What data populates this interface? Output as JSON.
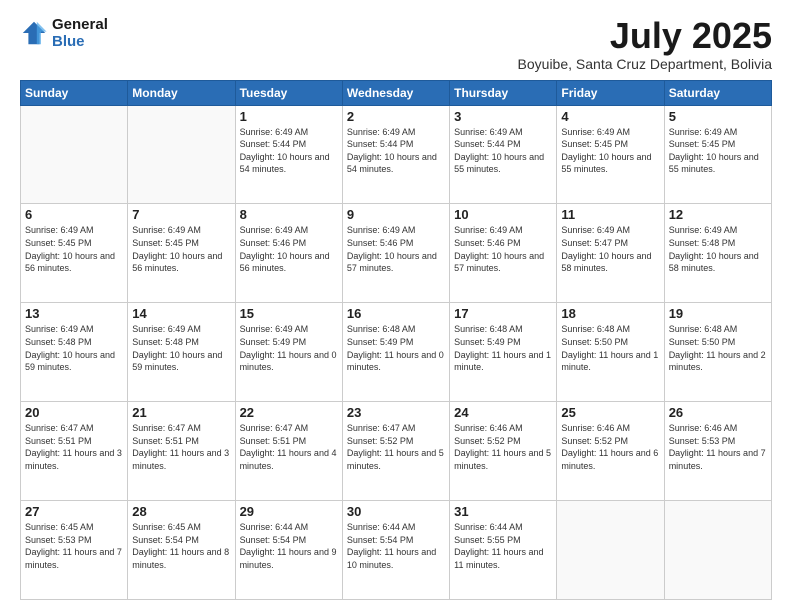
{
  "logo": {
    "line1": "General",
    "line2": "Blue"
  },
  "title": "July 2025",
  "subtitle": "Boyuibe, Santa Cruz Department, Bolivia",
  "days_of_week": [
    "Sunday",
    "Monday",
    "Tuesday",
    "Wednesday",
    "Thursday",
    "Friday",
    "Saturday"
  ],
  "weeks": [
    [
      {
        "day": "",
        "info": ""
      },
      {
        "day": "",
        "info": ""
      },
      {
        "day": "1",
        "info": "Sunrise: 6:49 AM\nSunset: 5:44 PM\nDaylight: 10 hours and 54 minutes."
      },
      {
        "day": "2",
        "info": "Sunrise: 6:49 AM\nSunset: 5:44 PM\nDaylight: 10 hours and 54 minutes."
      },
      {
        "day": "3",
        "info": "Sunrise: 6:49 AM\nSunset: 5:44 PM\nDaylight: 10 hours and 55 minutes."
      },
      {
        "day": "4",
        "info": "Sunrise: 6:49 AM\nSunset: 5:45 PM\nDaylight: 10 hours and 55 minutes."
      },
      {
        "day": "5",
        "info": "Sunrise: 6:49 AM\nSunset: 5:45 PM\nDaylight: 10 hours and 55 minutes."
      }
    ],
    [
      {
        "day": "6",
        "info": "Sunrise: 6:49 AM\nSunset: 5:45 PM\nDaylight: 10 hours and 56 minutes."
      },
      {
        "day": "7",
        "info": "Sunrise: 6:49 AM\nSunset: 5:45 PM\nDaylight: 10 hours and 56 minutes."
      },
      {
        "day": "8",
        "info": "Sunrise: 6:49 AM\nSunset: 5:46 PM\nDaylight: 10 hours and 56 minutes."
      },
      {
        "day": "9",
        "info": "Sunrise: 6:49 AM\nSunset: 5:46 PM\nDaylight: 10 hours and 57 minutes."
      },
      {
        "day": "10",
        "info": "Sunrise: 6:49 AM\nSunset: 5:46 PM\nDaylight: 10 hours and 57 minutes."
      },
      {
        "day": "11",
        "info": "Sunrise: 6:49 AM\nSunset: 5:47 PM\nDaylight: 10 hours and 58 minutes."
      },
      {
        "day": "12",
        "info": "Sunrise: 6:49 AM\nSunset: 5:48 PM\nDaylight: 10 hours and 58 minutes."
      }
    ],
    [
      {
        "day": "13",
        "info": "Sunrise: 6:49 AM\nSunset: 5:48 PM\nDaylight: 10 hours and 59 minutes."
      },
      {
        "day": "14",
        "info": "Sunrise: 6:49 AM\nSunset: 5:48 PM\nDaylight: 10 hours and 59 minutes."
      },
      {
        "day": "15",
        "info": "Sunrise: 6:49 AM\nSunset: 5:49 PM\nDaylight: 11 hours and 0 minutes."
      },
      {
        "day": "16",
        "info": "Sunrise: 6:48 AM\nSunset: 5:49 PM\nDaylight: 11 hours and 0 minutes."
      },
      {
        "day": "17",
        "info": "Sunrise: 6:48 AM\nSunset: 5:49 PM\nDaylight: 11 hours and 1 minute."
      },
      {
        "day": "18",
        "info": "Sunrise: 6:48 AM\nSunset: 5:50 PM\nDaylight: 11 hours and 1 minute."
      },
      {
        "day": "19",
        "info": "Sunrise: 6:48 AM\nSunset: 5:50 PM\nDaylight: 11 hours and 2 minutes."
      }
    ],
    [
      {
        "day": "20",
        "info": "Sunrise: 6:47 AM\nSunset: 5:51 PM\nDaylight: 11 hours and 3 minutes."
      },
      {
        "day": "21",
        "info": "Sunrise: 6:47 AM\nSunset: 5:51 PM\nDaylight: 11 hours and 3 minutes."
      },
      {
        "day": "22",
        "info": "Sunrise: 6:47 AM\nSunset: 5:51 PM\nDaylight: 11 hours and 4 minutes."
      },
      {
        "day": "23",
        "info": "Sunrise: 6:47 AM\nSunset: 5:52 PM\nDaylight: 11 hours and 5 minutes."
      },
      {
        "day": "24",
        "info": "Sunrise: 6:46 AM\nSunset: 5:52 PM\nDaylight: 11 hours and 5 minutes."
      },
      {
        "day": "25",
        "info": "Sunrise: 6:46 AM\nSunset: 5:52 PM\nDaylight: 11 hours and 6 minutes."
      },
      {
        "day": "26",
        "info": "Sunrise: 6:46 AM\nSunset: 5:53 PM\nDaylight: 11 hours and 7 minutes."
      }
    ],
    [
      {
        "day": "27",
        "info": "Sunrise: 6:45 AM\nSunset: 5:53 PM\nDaylight: 11 hours and 7 minutes."
      },
      {
        "day": "28",
        "info": "Sunrise: 6:45 AM\nSunset: 5:54 PM\nDaylight: 11 hours and 8 minutes."
      },
      {
        "day": "29",
        "info": "Sunrise: 6:44 AM\nSunset: 5:54 PM\nDaylight: 11 hours and 9 minutes."
      },
      {
        "day": "30",
        "info": "Sunrise: 6:44 AM\nSunset: 5:54 PM\nDaylight: 11 hours and 10 minutes."
      },
      {
        "day": "31",
        "info": "Sunrise: 6:44 AM\nSunset: 5:55 PM\nDaylight: 11 hours and 11 minutes."
      },
      {
        "day": "",
        "info": ""
      },
      {
        "day": "",
        "info": ""
      }
    ]
  ]
}
